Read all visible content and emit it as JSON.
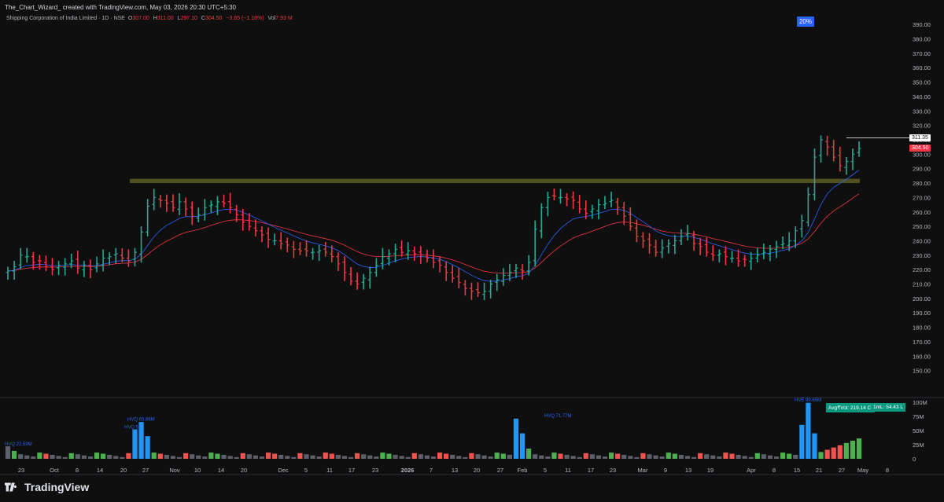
{
  "header": {
    "attribution": "The_Chart_Wizard_ created with TradingView.com, May 03, 2026 20:30 UTC+5:30",
    "symbol": "Shipping Corporation of India Limited · 1D · NSE",
    "open_label": "O",
    "open": "307.00",
    "high_label": "H",
    "high": "311.00",
    "low_label": "L",
    "low": "297.10",
    "close_label": "C",
    "close": "304.50",
    "change": "−3.65 (−1.18%)",
    "vol_label": "Vol",
    "vol": "7.93 M"
  },
  "badge": {
    "percent": "20%"
  },
  "price_tags": {
    "high": "311.35",
    "close": "304.50"
  },
  "volume_labels": {
    "avg": "Avg₹Vol: 219.14 Cr",
    "one_ml": "1mL: 54.43 L"
  },
  "brand": {
    "name": "TradingView"
  },
  "colors": {
    "up": "#22ab94",
    "down": "#f23645",
    "ema_fast": "#2962ff",
    "ema_slow": "#f23645",
    "zone": "#5b5a22",
    "vol_up": "#4caf50",
    "vol_down": "#ef5350",
    "vol_hv": "#2196f3",
    "vol_neutral": "#5d606b"
  },
  "chart_data": {
    "type": "bar",
    "title": "Shipping Corporation of India Limited · 1D · NSE",
    "ylim": [
      140,
      395
    ],
    "y_ticks": [
      "390.00",
      "380.00",
      "370.00",
      "360.00",
      "350.00",
      "340.00",
      "330.00",
      "320.00",
      "310.00",
      "300.00",
      "290.00",
      "280.00",
      "270.00",
      "260.00",
      "250.00",
      "240.00",
      "230.00",
      "220.00",
      "210.00",
      "200.00",
      "190.00",
      "180.00",
      "170.00",
      "160.00",
      "150.00"
    ],
    "x_ticks": [
      "23",
      "Oct",
      "8",
      "14",
      "20",
      "27",
      "Nov",
      "10",
      "14",
      "20",
      "Dec",
      "5",
      "11",
      "17",
      "23",
      "2026",
      "7",
      "13",
      "20",
      "27",
      "Feb",
      "5",
      "11",
      "17",
      "23",
      "Mar",
      "9",
      "13",
      "19",
      "Apr",
      "8",
      "15",
      "21",
      "27",
      "May",
      "8"
    ],
    "resistance_zone": [
      280,
      283
    ],
    "price_path": [
      219,
      222,
      230,
      229,
      225,
      226,
      222,
      220,
      223,
      224,
      226,
      221,
      223,
      220,
      224,
      228,
      229,
      231,
      228,
      226,
      232,
      246,
      264,
      270,
      268,
      266,
      263,
      267,
      262,
      257,
      258,
      263,
      265,
      267,
      266,
      263,
      258,
      253,
      250,
      247,
      244,
      241,
      240,
      238,
      237,
      234,
      233,
      233,
      232,
      233,
      232,
      229,
      224,
      218,
      212,
      210,
      214,
      218,
      223,
      229,
      231,
      234,
      232,
      233,
      231,
      230,
      228,
      225,
      223,
      218,
      214,
      211,
      207,
      205,
      204,
      205,
      210,
      213,
      216,
      218,
      221,
      219,
      225,
      248,
      263,
      270,
      271,
      270,
      269,
      268,
      262,
      259,
      262,
      265,
      266,
      268,
      263,
      257,
      250,
      243,
      240,
      237,
      232,
      235,
      238,
      240,
      243,
      245,
      238,
      236,
      232,
      230,
      231,
      229,
      228,
      226,
      227,
      228,
      230,
      232,
      234,
      236,
      238,
      240,
      247,
      254,
      272,
      298,
      310,
      305,
      298,
      292,
      295,
      300,
      304
    ],
    "volume": {
      "ylim": [
        0,
        100
      ],
      "y_ticks": [
        "100M",
        "75M",
        "50M",
        "25M",
        "0"
      ],
      "annotations": [
        "HVQ 22.59M",
        "HVQ 51",
        "HVQ 65.86M",
        "HVQ 71.77M",
        "HVE 99.65M"
      ]
    }
  }
}
